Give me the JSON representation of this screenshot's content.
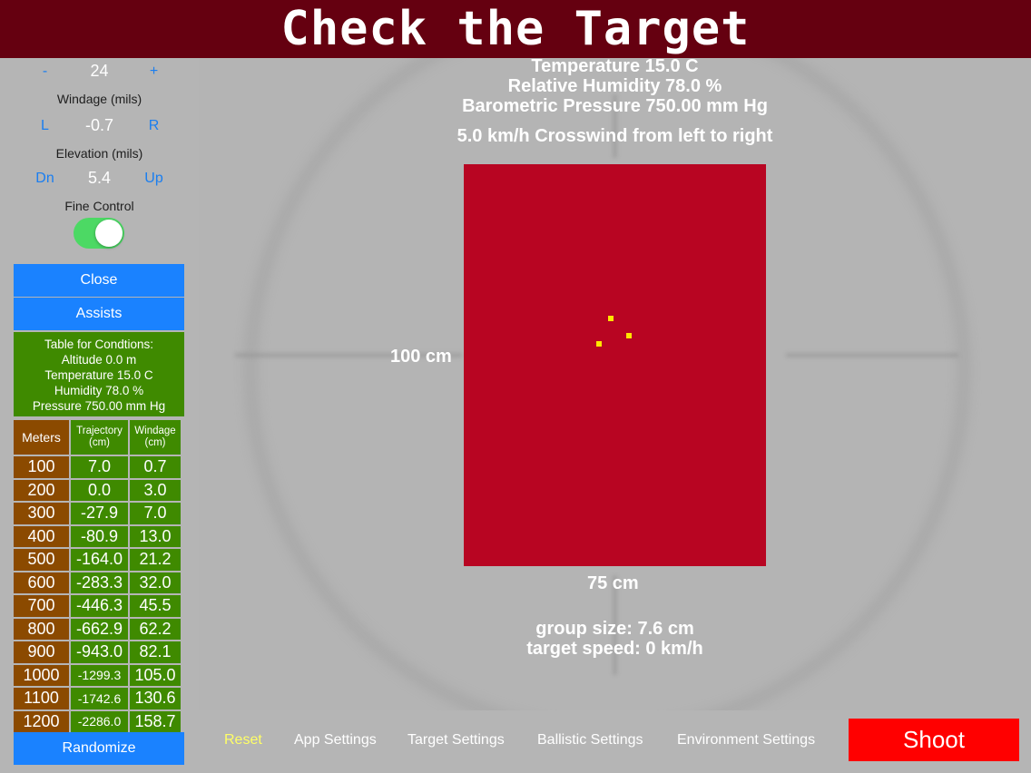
{
  "title": "Check the Target",
  "side": {
    "range_minus": "-",
    "range_value": "24",
    "range_plus": "+",
    "windage_label": "Windage (mils)",
    "windage_left": "L",
    "windage_value": "-0.7",
    "windage_right": "R",
    "elevation_label": "Elevation (mils)",
    "elevation_down": "Dn",
    "elevation_value": "5.4",
    "elevation_up": "Up",
    "fine_control_label": "Fine Control",
    "fine_control_on": true,
    "close_label": "Close",
    "assists_label": "Assists",
    "conditions": [
      "Table for Condtions:",
      "Altitude 0.0 m",
      "Temperature 15.0 C",
      "Humidity 78.0 %",
      "Pressure 750.00 mm Hg"
    ],
    "table": {
      "headers": [
        "Meters",
        "Trajectory\n(cm)",
        "Windage\n(cm)"
      ],
      "rows": [
        [
          "100",
          "7.0",
          "0.7"
        ],
        [
          "200",
          "0.0",
          "3.0"
        ],
        [
          "300",
          "-27.9",
          "7.0"
        ],
        [
          "400",
          "-80.9",
          "13.0"
        ],
        [
          "500",
          "-164.0",
          "21.2"
        ],
        [
          "600",
          "-283.3",
          "32.0"
        ],
        [
          "700",
          "-446.3",
          "45.5"
        ],
        [
          "800",
          "-662.9",
          "62.2"
        ],
        [
          "900",
          "-943.0",
          "82.1"
        ],
        [
          "1000",
          "-1299.3",
          "105.0"
        ],
        [
          "1100",
          "-1742.6",
          "130.6"
        ],
        [
          "1200",
          "-2286.0",
          "158.7"
        ]
      ]
    },
    "randomize_label": "Randomize"
  },
  "scope": {
    "temperature": "Temperature 15.0 C",
    "humidity": "Relative Humidity 78.0 %",
    "pressure": "Barometric Pressure 750.00 mm Hg",
    "wind": "5.0 km/h Crosswind from left to right",
    "target_height_label": "100 cm",
    "target_width_label": "75 cm",
    "group_size": "group size: 7.6 cm",
    "target_speed": "target speed: 0 km/h",
    "target_color": "#b80522",
    "shot_color": "#ffe600"
  },
  "toolbar": {
    "reset": "Reset",
    "app_settings": "App Settings",
    "target_settings": "Target Settings",
    "ballistic_settings": "Ballistic Settings",
    "environment_settings": "Environment Settings",
    "shoot": "Shoot"
  }
}
